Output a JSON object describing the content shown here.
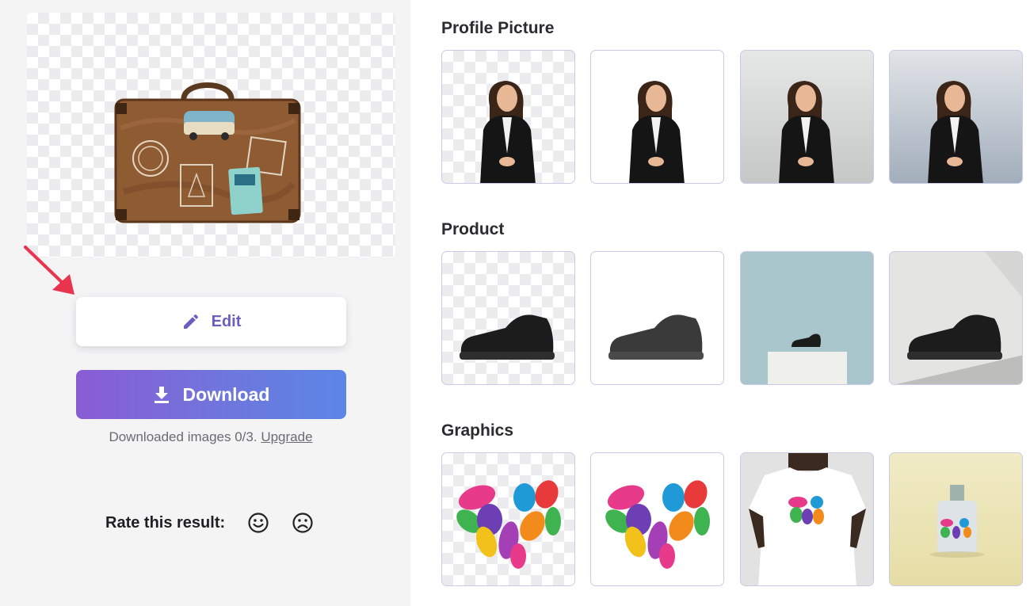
{
  "left_panel": {
    "edit_label": "Edit",
    "download_label": "Download",
    "downloads_text": "Downloaded images 0/3.",
    "upgrade_link": "Upgrade",
    "rate_label": "Rate this result:",
    "icons": [
      "pencil-icon",
      "download-icon",
      "smile-icon",
      "frown-icon",
      "red-arrow"
    ]
  },
  "sections": [
    {
      "title": "Profile Picture",
      "tiles": [
        "transparent",
        "white",
        "light-gray-gradient",
        "blue-gray-gradient"
      ]
    },
    {
      "title": "Product",
      "tiles": [
        "transparent",
        "white",
        "teal-pedestal",
        "gray-angled"
      ]
    },
    {
      "title": "Graphics",
      "tiles": [
        "transparent",
        "white",
        "t-shirt",
        "bottle"
      ]
    }
  ],
  "colors": {
    "accent": "#6a5fc1",
    "download_gradient_start": "#8a5cd4",
    "download_gradient_end": "#5b86e6",
    "arrow": "#e8344d"
  }
}
